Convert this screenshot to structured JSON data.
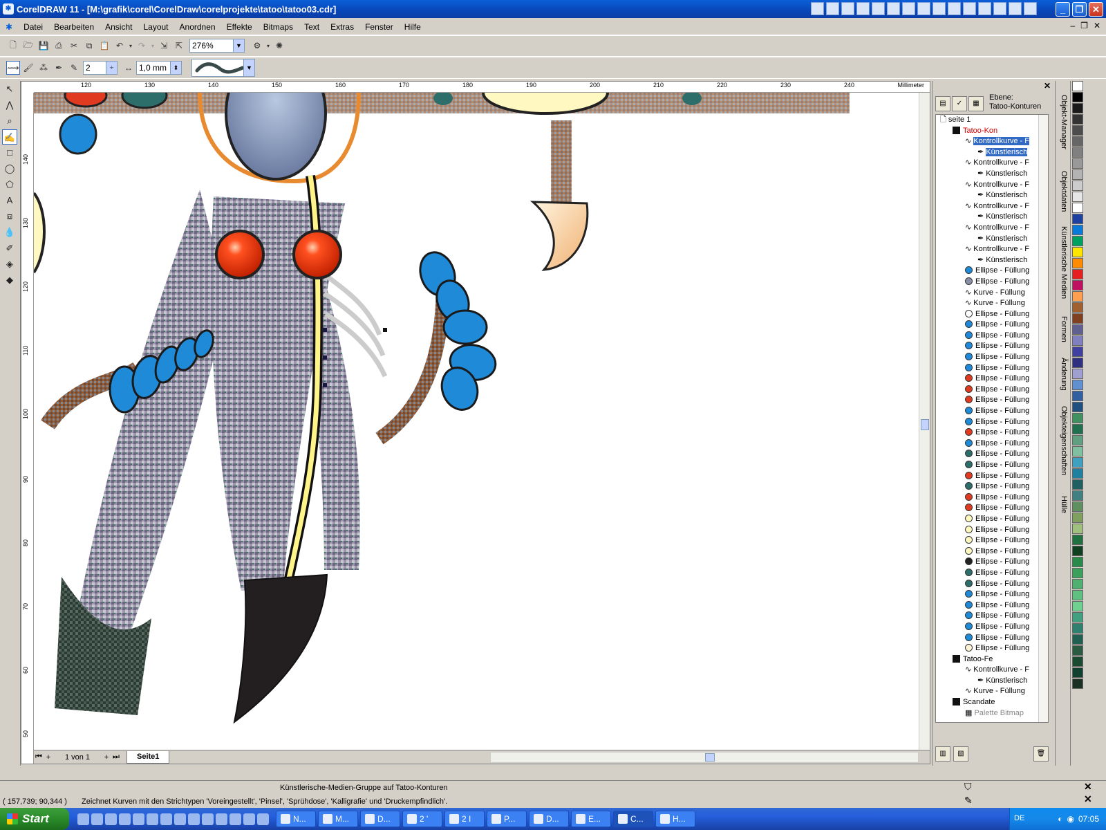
{
  "window": {
    "title": "CorelDRAW 11 - [M:\\grafik\\corel\\CorelDraw\\corelprojekte\\tatoo\\tatoo03.cdr]",
    "app_icon": "coreldraw-balloon-icon"
  },
  "menu": {
    "items": [
      "Datei",
      "Bearbeiten",
      "Ansicht",
      "Layout",
      "Anordnen",
      "Effekte",
      "Bitmaps",
      "Text",
      "Extras",
      "Fenster",
      "Hilfe"
    ]
  },
  "toolbar": {
    "zoom": "276%",
    "nib_size": "2",
    "stroke_width": "1,0 mm"
  },
  "ruler": {
    "unit": "Millimeter",
    "h_ticks": [
      "120",
      "130",
      "140",
      "150",
      "160",
      "170",
      "180",
      "190",
      "200",
      "210",
      "220",
      "230",
      "240"
    ],
    "v_ticks": [
      "140",
      "130",
      "120",
      "110",
      "100",
      "90",
      "80",
      "70",
      "60",
      "50"
    ]
  },
  "page_nav": {
    "pages_label": "1 von 1",
    "tab": "Seite1"
  },
  "docker": {
    "layer_prefix": "Ebene:",
    "layer_name": "Tatoo-Konturen",
    "tree": [
      {
        "indent": 0,
        "icon": "page",
        "label": "seite 1"
      },
      {
        "indent": 1,
        "icon": "layer",
        "label": "Tatoo-Kon",
        "style": "red"
      },
      {
        "indent": 2,
        "icon": "curve",
        "label": "Kontrollkurve - F",
        "style": "sel"
      },
      {
        "indent": 3,
        "icon": "brush",
        "label": "Künstlerisch",
        "style": "sel"
      },
      {
        "indent": 2,
        "icon": "curve",
        "label": "Kontrollkurve - F"
      },
      {
        "indent": 3,
        "icon": "brush",
        "label": "Künstlerisch"
      },
      {
        "indent": 2,
        "icon": "curve",
        "label": "Kontrollkurve - F"
      },
      {
        "indent": 3,
        "icon": "brush",
        "label": "Künstlerisch"
      },
      {
        "indent": 2,
        "icon": "curve",
        "label": "Kontrollkurve - F"
      },
      {
        "indent": 3,
        "icon": "brush",
        "label": "Künstlerisch"
      },
      {
        "indent": 2,
        "icon": "curve",
        "label": "Kontrollkurve - F"
      },
      {
        "indent": 3,
        "icon": "brush",
        "label": "Künstlerisch"
      },
      {
        "indent": 2,
        "icon": "curve",
        "label": "Kontrollkurve - F"
      },
      {
        "indent": 3,
        "icon": "brush",
        "label": "Künstlerisch"
      },
      {
        "indent": 2,
        "icon": "ellipse",
        "color": "#1f8ad8",
        "label": "Ellipse - Füllung"
      },
      {
        "indent": 2,
        "icon": "ellipse",
        "color": "#8a8fa8",
        "label": "Ellipse - Füllung"
      },
      {
        "indent": 2,
        "icon": "curve",
        "label": "Kurve - Füllung"
      },
      {
        "indent": 2,
        "icon": "curve",
        "label": "Kurve - Füllung"
      },
      {
        "indent": 2,
        "icon": "ellipse",
        "color": "#ffffff",
        "label": "Ellipse - Füllung"
      },
      {
        "indent": 2,
        "icon": "ellipse",
        "color": "#1f8ad8",
        "label": "Ellipse - Füllung"
      },
      {
        "indent": 2,
        "icon": "ellipse",
        "color": "#1f8ad8",
        "label": "Ellipse - Füllung"
      },
      {
        "indent": 2,
        "icon": "ellipse",
        "color": "#1f8ad8",
        "label": "Ellipse - Füllung"
      },
      {
        "indent": 2,
        "icon": "ellipse",
        "color": "#1f8ad8",
        "label": "Ellipse - Füllung"
      },
      {
        "indent": 2,
        "icon": "ellipse",
        "color": "#1f8ad8",
        "label": "Ellipse - Füllung"
      },
      {
        "indent": 2,
        "icon": "ellipse",
        "color": "#e03a20",
        "label": "Ellipse - Füllung"
      },
      {
        "indent": 2,
        "icon": "ellipse",
        "color": "#e03a20",
        "label": "Ellipse - Füllung"
      },
      {
        "indent": 2,
        "icon": "ellipse",
        "color": "#e03a20",
        "label": "Ellipse - Füllung"
      },
      {
        "indent": 2,
        "icon": "ellipse",
        "color": "#1f8ad8",
        "label": "Ellipse - Füllung"
      },
      {
        "indent": 2,
        "icon": "ellipse",
        "color": "#1f8ad8",
        "label": "Ellipse - Füllung"
      },
      {
        "indent": 2,
        "icon": "ellipse",
        "color": "#e03a20",
        "label": "Ellipse - Füllung"
      },
      {
        "indent": 2,
        "icon": "ellipse",
        "color": "#1f8ad8",
        "label": "Ellipse - Füllung"
      },
      {
        "indent": 2,
        "icon": "ellipse",
        "color": "#2e6e6a",
        "label": "Ellipse - Füllung"
      },
      {
        "indent": 2,
        "icon": "ellipse",
        "color": "#2e6e6a",
        "label": "Ellipse - Füllung"
      },
      {
        "indent": 2,
        "icon": "ellipse",
        "color": "#e03a20",
        "label": "Ellipse - Füllung"
      },
      {
        "indent": 2,
        "icon": "ellipse",
        "color": "#2e6e6a",
        "label": "Ellipse - Füllung"
      },
      {
        "indent": 2,
        "icon": "ellipse",
        "color": "#e03a20",
        "label": "Ellipse - Füllung"
      },
      {
        "indent": 2,
        "icon": "ellipse",
        "color": "#e03a20",
        "label": "Ellipse - Füllung"
      },
      {
        "indent": 2,
        "icon": "ellipse",
        "color": "#fff8c0",
        "label": "Ellipse - Füllung"
      },
      {
        "indent": 2,
        "icon": "ellipse",
        "color": "#fff8c0",
        "label": "Ellipse - Füllung"
      },
      {
        "indent": 2,
        "icon": "ellipse",
        "color": "#fff8c0",
        "label": "Ellipse - Füllung"
      },
      {
        "indent": 2,
        "icon": "ellipse",
        "color": "#fff8c0",
        "label": "Ellipse - Füllung"
      },
      {
        "indent": 2,
        "icon": "ellipse",
        "color": "#222222",
        "label": "Ellipse - Füllung"
      },
      {
        "indent": 2,
        "icon": "ellipse",
        "color": "#2e6e6a",
        "label": "Ellipse - Füllung"
      },
      {
        "indent": 2,
        "icon": "ellipse",
        "color": "#2e6e6a",
        "label": "Ellipse - Füllung"
      },
      {
        "indent": 2,
        "icon": "ellipse",
        "color": "#1f8ad8",
        "label": "Ellipse - Füllung"
      },
      {
        "indent": 2,
        "icon": "ellipse",
        "color": "#1f8ad8",
        "label": "Ellipse - Füllung"
      },
      {
        "indent": 2,
        "icon": "ellipse",
        "color": "#1f8ad8",
        "label": "Ellipse - Füllung"
      },
      {
        "indent": 2,
        "icon": "ellipse",
        "color": "#1f8ad8",
        "label": "Ellipse - Füllung"
      },
      {
        "indent": 2,
        "icon": "ellipse",
        "color": "#1f8ad8",
        "label": "Ellipse - Füllung"
      },
      {
        "indent": 2,
        "icon": "ellipse",
        "color": "#fff4d8",
        "label": "Ellipse - Füllung"
      },
      {
        "indent": 1,
        "icon": "layer",
        "label": "Tatoo-Fe"
      },
      {
        "indent": 2,
        "icon": "curve",
        "label": "Kontrollkurve - F"
      },
      {
        "indent": 3,
        "icon": "brush",
        "label": "Künstlerisch"
      },
      {
        "indent": 2,
        "icon": "curve",
        "label": "Kurve - Füllung"
      },
      {
        "indent": 1,
        "icon": "layer",
        "label": "Scandate"
      },
      {
        "indent": 2,
        "icon": "bitmap",
        "label": "Palette Bitmap",
        "style": "gray"
      }
    ]
  },
  "docker_tabs": [
    "Objekt-Manager",
    "Objektdaten",
    "Künstlerische Medien",
    "Formen",
    "Änderung",
    "Objekteigenschaften",
    "Hülle"
  ],
  "palette": [
    "#ffffff",
    "#000000",
    "#1a1a1a",
    "#333333",
    "#4d4d4d",
    "#666666",
    "#808080",
    "#999999",
    "#b3b3b3",
    "#cccccc",
    "#e6e6e6",
    "#ffffff",
    "#1e40a0",
    "#0a7ad8",
    "#00a060",
    "#ffe600",
    "#ff8c00",
    "#e62020",
    "#c01060",
    "#ff9f50",
    "#a06030",
    "#804020",
    "#606090",
    "#8080c0",
    "#4040a0",
    "#303080",
    "#a0a0d0",
    "#6090d0",
    "#3060a0",
    "#205080",
    "#409060",
    "#207050",
    "#60a080",
    "#80c0a0",
    "#40a0c0",
    "#2080a0",
    "#206060",
    "#408080",
    "#609060",
    "#80a060",
    "#a0c080",
    "#207040",
    "#104020",
    "#2a8a4a",
    "#3aa05a",
    "#50b070",
    "#60c080",
    "#70d090",
    "#40a080",
    "#308070",
    "#206050",
    "#2a5a40",
    "#1a4a30",
    "#104030",
    "#1a3020"
  ],
  "status": {
    "line1": "Künstlerische-Medien-Gruppe auf Tatoo-Konturen",
    "coords": "( 157,739; 90,344 )",
    "line2": "Zeichnet Kurven mit den Strichtypen 'Voreingestellt', 'Pinsel', 'Sprühdose', 'Kalligrafie' und 'Druckempfindlich'."
  },
  "taskbar": {
    "start_label": "Start",
    "tasks": [
      "N...",
      "M...",
      "D...",
      "2 '",
      "2 I",
      "P...",
      "D...",
      "E...",
      "C...",
      "H..."
    ],
    "lang": "DE",
    "clock": "07:05"
  },
  "colors": {
    "titlebar": "#0846b8",
    "bead_blue": "#1f8ad8",
    "bead_red": "#e03a20",
    "quill_yellow": "#fff48a",
    "selection": "#316ac5"
  }
}
